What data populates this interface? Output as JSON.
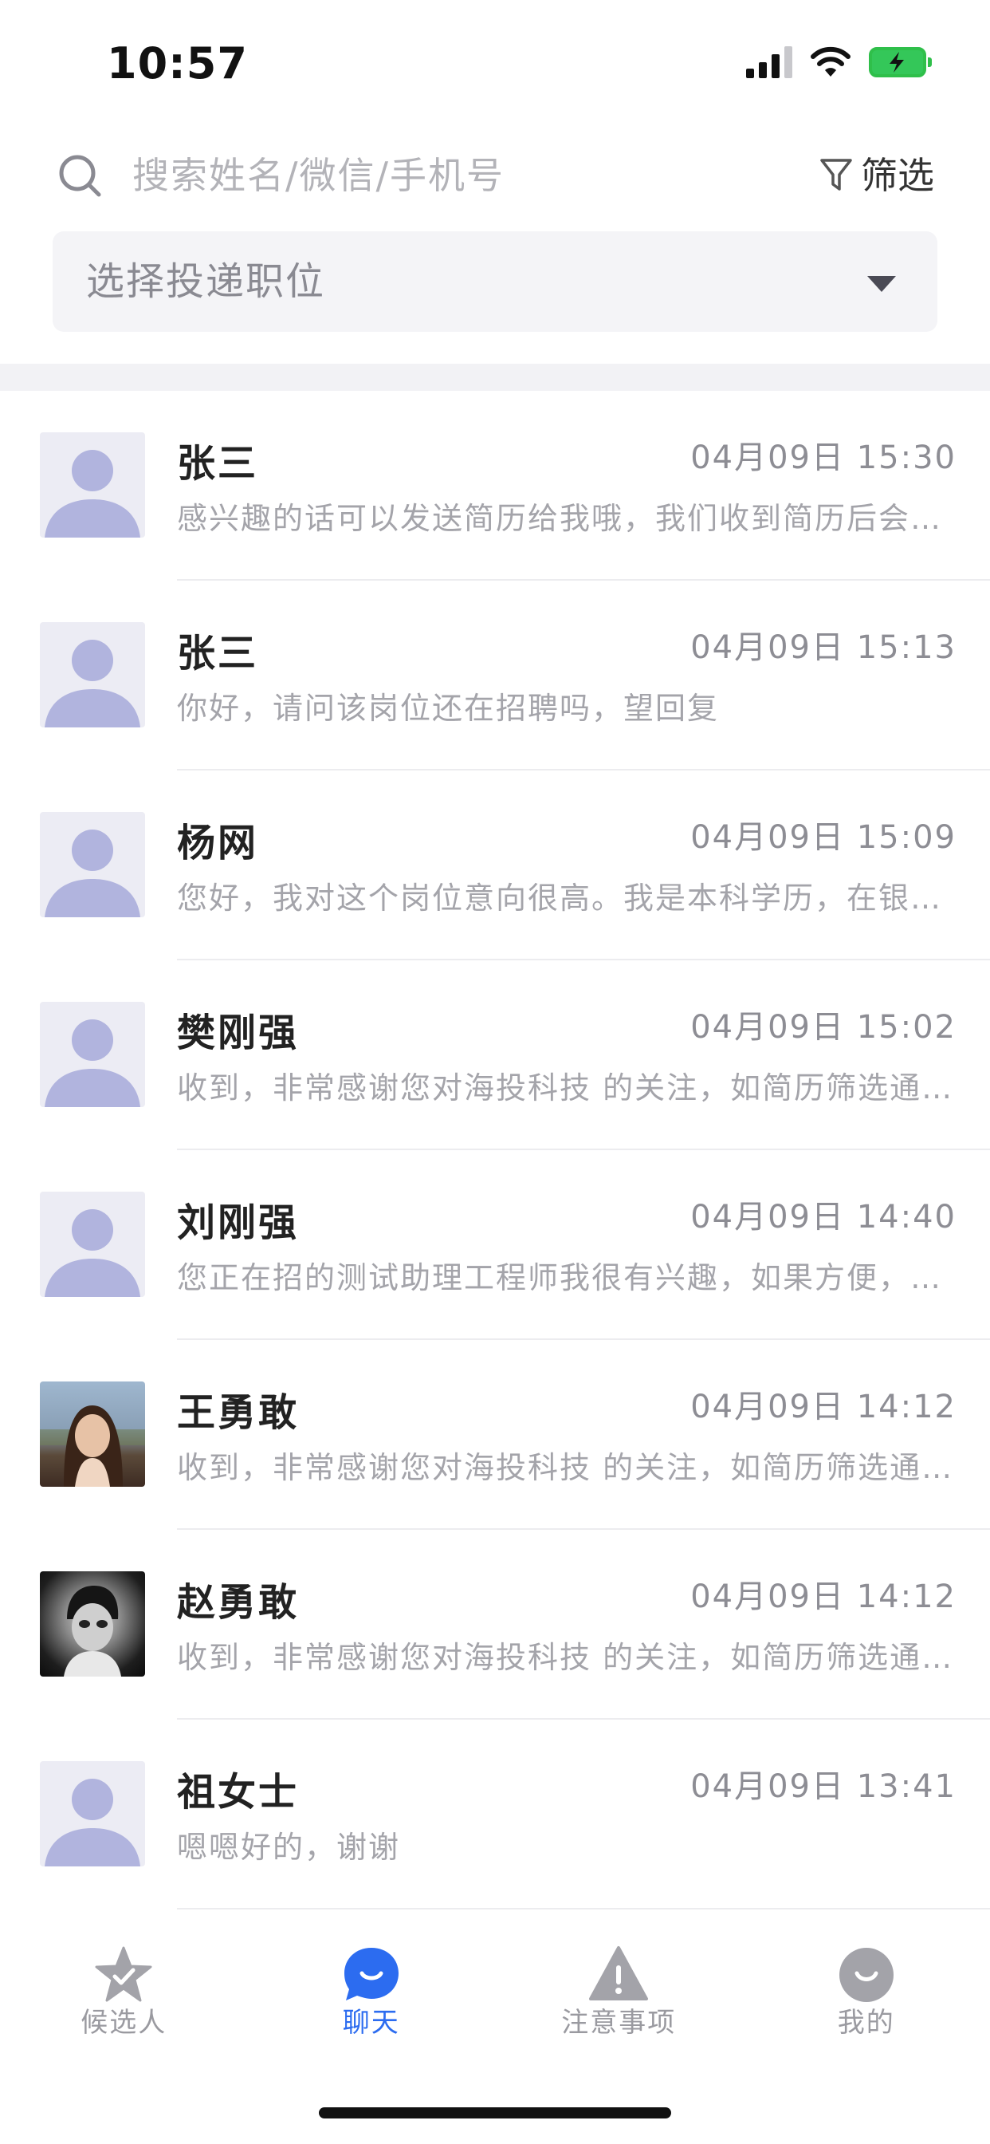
{
  "status_bar": {
    "time": "10:57",
    "icons": [
      "cellular-signal-icon",
      "wifi-icon",
      "battery-charging-icon"
    ],
    "battery_color": "#34c759"
  },
  "search": {
    "placeholder": "搜索姓名/微信/手机号",
    "icon": "search-icon",
    "filter_label": "筛选",
    "filter_icon": "filter-icon"
  },
  "position_select": {
    "label": "选择投递职位",
    "icon": "caret-down-icon"
  },
  "chats": [
    {
      "name": "张三",
      "time": "04月09日 15:30",
      "preview": "感兴趣的话可以发送简历给我哦，我们收到简历后会…",
      "avatar": "default"
    },
    {
      "name": "张三",
      "time": "04月09日 15:13",
      "preview": "你好，请问该岗位还在招聘吗，望回复",
      "avatar": "default"
    },
    {
      "name": "杨网",
      "time": "04月09日 15:09",
      "preview": "您好，我对这个岗位意向很高。我是本科学历，在银…",
      "avatar": "default"
    },
    {
      "name": "樊刚强",
      "time": "04月09日 15:02",
      "preview": "收到，非常感谢您对海投科技 的关注，如简历筛选通…",
      "avatar": "default"
    },
    {
      "name": "刘刚强",
      "time": "04月09日 14:40",
      "preview": "您正在招的测试助理工程师我很有兴趣，如果方便，…",
      "avatar": "default"
    },
    {
      "name": "王勇敢",
      "time": "04月09日 14:12",
      "preview": "收到，非常感谢您对海投科技 的关注，如简历筛选通…",
      "avatar": "photo-1"
    },
    {
      "name": "赵勇敢",
      "time": "04月09日 14:12",
      "preview": "收到，非常感谢您对海投科技 的关注，如简历筛选通…",
      "avatar": "photo-2"
    },
    {
      "name": "祖女士",
      "time": "04月09日 13:41",
      "preview": "嗯嗯好的，谢谢",
      "avatar": "default"
    }
  ],
  "tab_bar": {
    "active_color": "#2c6cf0",
    "inactive_color": "#9a9aa0",
    "tabs": [
      {
        "label": "候选人",
        "icon": "star-check-icon"
      },
      {
        "label": "聊天",
        "icon": "chat-bubble-icon",
        "active": true
      },
      {
        "label": "注意事项",
        "icon": "warning-icon"
      },
      {
        "label": "我的",
        "icon": "profile-smile-icon"
      }
    ]
  }
}
